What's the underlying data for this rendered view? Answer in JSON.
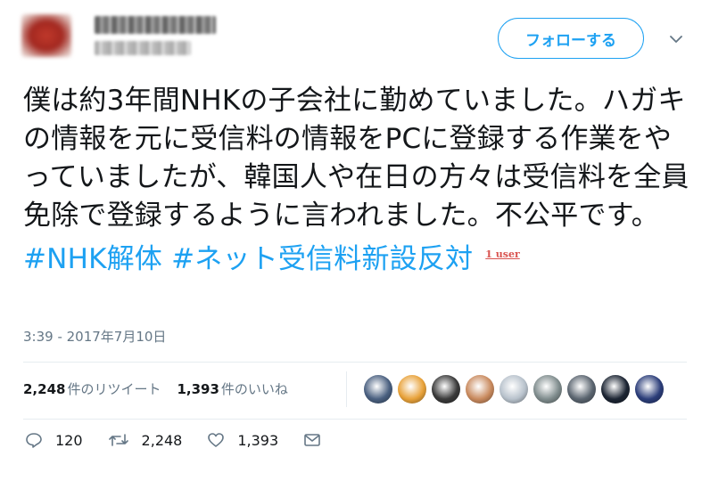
{
  "header": {
    "follow_label": "フォローする"
  },
  "tweet": {
    "text": "僕は約3年間NHKの子会社に勤めていました。ハガキの情報を元に受信料の情報をPCに登録する作業をやっていましたが、韓国人や在日の方々は受信料を全員免除で登録するように言われました。不公平です。",
    "hashtags": [
      "#NHK解体",
      "#ネット受信料新設反対"
    ],
    "user_badge": "1 user"
  },
  "timestamp": "3:39 - 2017年7月10日",
  "stats": {
    "retweets_count": "2,248",
    "retweets_label": "件のリツイート",
    "likes_count": "1,393",
    "likes_label": "件のいいね"
  },
  "likers": [
    {
      "icon": "liker-avatar-1",
      "color": "#4a6080"
    },
    {
      "icon": "liker-avatar-2",
      "color": "#e8a23a"
    },
    {
      "icon": "liker-avatar-3",
      "color": "#3a3a3a"
    },
    {
      "icon": "liker-avatar-4",
      "color": "#c98a5e"
    },
    {
      "icon": "liker-avatar-5",
      "color": "#b8c2cc"
    },
    {
      "icon": "liker-avatar-6",
      "color": "#7f8c8d"
    },
    {
      "icon": "liker-avatar-7",
      "color": "#5b6570"
    },
    {
      "icon": "liker-avatar-8",
      "color": "#1c2533"
    },
    {
      "icon": "liker-avatar-9",
      "color": "#2c3e7a"
    }
  ],
  "actions": {
    "reply_count": "120",
    "retweet_count": "2,248",
    "like_count": "1,393"
  },
  "colors": {
    "accent": "#1da1f2",
    "text": "#14171a",
    "muted": "#657786",
    "badge": "#d9534f"
  }
}
